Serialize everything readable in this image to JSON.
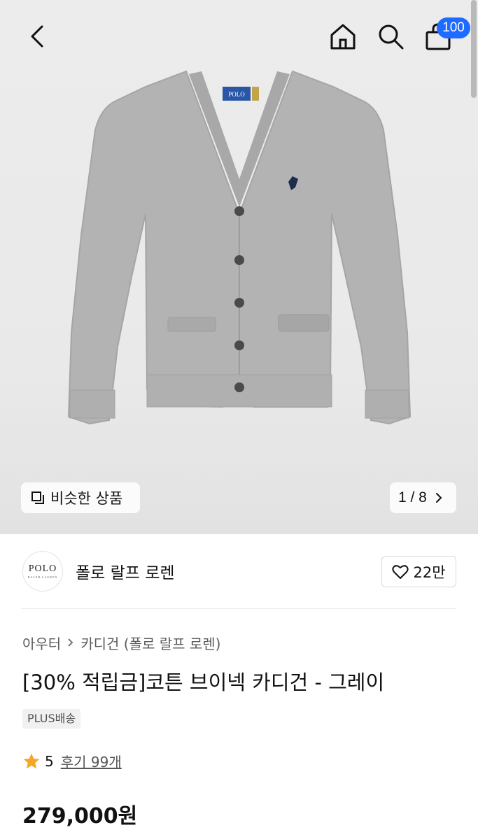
{
  "header": {
    "back_icon": "chevron-left-icon",
    "home_icon": "home-icon",
    "search_icon": "search-icon",
    "cart_icon": "shopping-bag-icon",
    "cart_count": "100",
    "badge_color": "#1f6bff"
  },
  "gallery": {
    "similar_label": "비슷한 상품",
    "similar_icon": "overlapping-squares-icon",
    "page_indicator": "1 / 8",
    "next_icon": "chevron-right-icon",
    "label_tag_text": "POLO"
  },
  "brand": {
    "logo_text": "POLO",
    "logo_subtext": "RALPH LAUREN",
    "name": "폴로 랄프 로렌",
    "like_icon": "heart-icon",
    "like_count": "22만"
  },
  "breadcrumb": {
    "items": [
      "아우터",
      "카디건 (폴로 랄프 로렌)"
    ]
  },
  "product": {
    "title": "[30% 적립금]코튼 브이넥 카디건 - 그레이",
    "shipping_badge": "PLUS배송",
    "rating_icon": "star-icon",
    "rating": "5",
    "reviews": "후기 99개",
    "price": "279,000원",
    "star_color": "#f5a623"
  }
}
